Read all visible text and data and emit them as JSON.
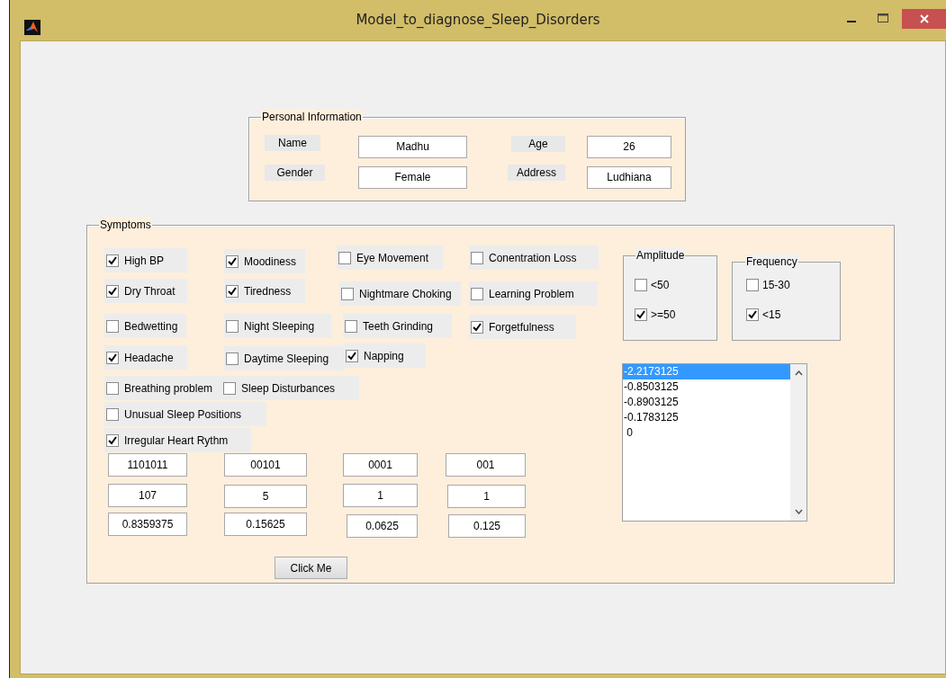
{
  "window": {
    "title": "Model_to_diagnose_Sleep_Disorders"
  },
  "personal_information": {
    "title": "Personal Information",
    "fields": [
      {
        "label": "Name",
        "value": "Madhu"
      },
      {
        "label": "Age",
        "value": "26"
      },
      {
        "label": "Gender",
        "value": "Female"
      },
      {
        "label": "Address",
        "value": "Ludhiana"
      }
    ]
  },
  "symptoms": {
    "title": "Symptoms",
    "checkboxes": [
      {
        "label": "High BP",
        "checked": true
      },
      {
        "label": "Moodiness",
        "checked": true
      },
      {
        "label": "Eye Movement",
        "checked": false
      },
      {
        "label": "Conentration Loss",
        "checked": false
      },
      {
        "label": "Dry Throat",
        "checked": true
      },
      {
        "label": "Tiredness",
        "checked": true
      },
      {
        "label": "Nightmare Choking",
        "checked": false
      },
      {
        "label": "Learning Problem",
        "checked": false
      },
      {
        "label": "Bedwetting",
        "checked": false
      },
      {
        "label": "Night Sleeping",
        "checked": false
      },
      {
        "label": "Teeth Grinding",
        "checked": false
      },
      {
        "label": "Forgetfulness",
        "checked": true
      },
      {
        "label": "Headache",
        "checked": true
      },
      {
        "label": "Daytime Sleeping",
        "checked": false
      },
      {
        "label": "Napping",
        "checked": true
      },
      {
        "label": "Breathing problem",
        "checked": false
      },
      {
        "label": "Sleep Disturbances",
        "checked": false
      },
      {
        "label": "Unusual Sleep Positions",
        "checked": false
      },
      {
        "label": "Irregular Heart Rythm",
        "checked": true
      }
    ],
    "groups": [
      {
        "title": "Amplitude",
        "options": [
          {
            "label": "<50",
            "checked": false
          },
          {
            "label": ">=50",
            "checked": true
          }
        ]
      },
      {
        "title": "Frequency",
        "options": [
          {
            "label": "15-30",
            "checked": false
          },
          {
            "label": "<15",
            "checked": true
          }
        ]
      }
    ],
    "value_fields": [
      [
        "1101011",
        "00101",
        "0001",
        "001"
      ],
      [
        "107",
        "5",
        "1",
        "1"
      ],
      [
        "0.8359375",
        "0.15625",
        "0.0625",
        "0.125"
      ]
    ],
    "listbox": {
      "items": [
        {
          "text": "-2.2173125",
          "selected": true
        },
        {
          "text": "-0.8503125",
          "selected": false
        },
        {
          "text": "-0.8903125",
          "selected": false
        },
        {
          "text": "-0.1783125",
          "selected": false
        },
        {
          "text": " 0",
          "selected": false
        }
      ]
    },
    "button": "Click Me"
  }
}
